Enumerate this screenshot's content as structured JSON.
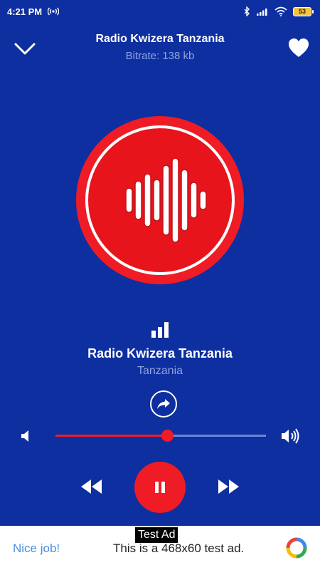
{
  "status_bar": {
    "time": "4:21 PM",
    "battery": "53"
  },
  "header": {
    "title": "Radio Kwizera Tanzania",
    "subtitle": "Bitrate: 138 kb"
  },
  "station": {
    "name": "Radio Kwizera Tanzania",
    "country": "Tanzania"
  },
  "volume": {
    "level": 0.53
  },
  "ad": {
    "label": "Test Ad",
    "cta": "Nice job!",
    "text": "This is a 468x60 test ad."
  },
  "colors": {
    "background": "#0e2fa0",
    "accent": "#ef1c25",
    "subtext": "#8ea4e0"
  },
  "icons": {
    "collapse": "chevron-down-icon",
    "favorite": "heart-icon",
    "signal": "signal-bars-icon",
    "share": "share-arrow-icon",
    "volume_down": "volume-low-icon",
    "volume_up": "volume-high-icon",
    "rewind": "rewind-icon",
    "pause": "pause-icon",
    "forward": "fast-forward-icon"
  }
}
